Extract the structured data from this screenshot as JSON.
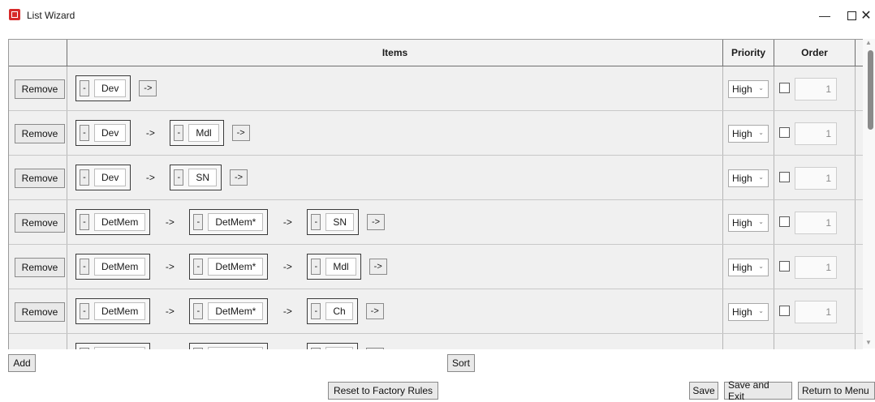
{
  "window": {
    "title": "List Wizard",
    "min_glyph": "—",
    "close_glyph": "✕"
  },
  "columns": {
    "remove": "",
    "items": "Items",
    "priority": "Priority",
    "order": "Order"
  },
  "rows": [
    {
      "remove": "Remove",
      "items": [
        "Dev"
      ],
      "arrow": "->",
      "priority": "High",
      "checked": false,
      "order": "1"
    },
    {
      "remove": "Remove",
      "items": [
        "Dev",
        "Mdl"
      ],
      "arrow": "->",
      "priority": "High",
      "checked": false,
      "order": "1"
    },
    {
      "remove": "Remove",
      "items": [
        "Dev",
        "SN"
      ],
      "arrow": "->",
      "priority": "High",
      "checked": false,
      "order": "1"
    },
    {
      "remove": "Remove",
      "items": [
        "DetMem",
        "DetMem*",
        "SN"
      ],
      "arrow": "->",
      "priority": "High",
      "checked": false,
      "order": "1"
    },
    {
      "remove": "Remove",
      "items": [
        "DetMem",
        "DetMem*",
        "Mdl"
      ],
      "arrow": "->",
      "priority": "High",
      "checked": false,
      "order": "1"
    },
    {
      "remove": "Remove",
      "items": [
        "DetMem",
        "DetMem*",
        "Ch"
      ],
      "arrow": "->",
      "priority": "High",
      "checked": false,
      "order": "1"
    }
  ],
  "token_minus": "-",
  "footer": {
    "add": "Add",
    "sort": "Sort",
    "reset": "Reset to Factory Rules",
    "save": "Save",
    "save_exit": "Save and Exit",
    "return_menu": "Return to Menu"
  },
  "colors": {
    "accent_icon": "#d72a2a"
  }
}
